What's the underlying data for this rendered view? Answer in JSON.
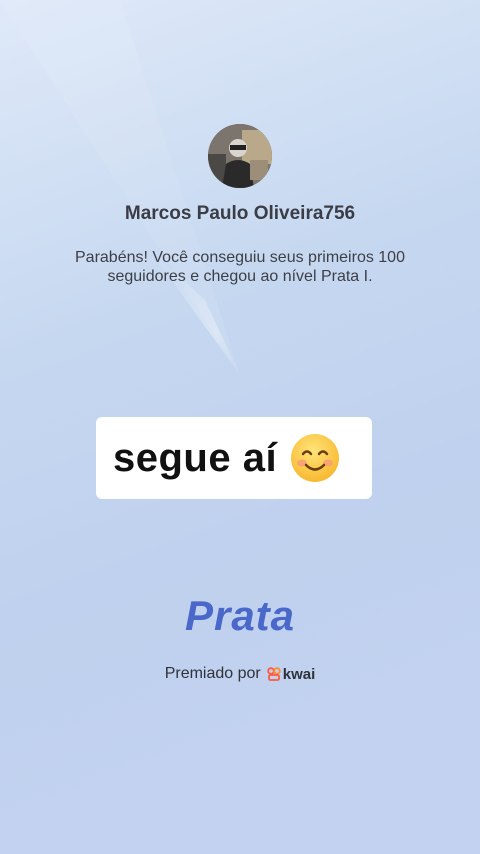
{
  "profile": {
    "username": "Marcos Paulo Oliveira756",
    "avatar_icon": "user-photo"
  },
  "message": "Parabéns! Você conseguiu seus primeiros 100 seguidores e chegou ao nível Prata I.",
  "sticker": {
    "text": "segue aí",
    "emoji_icon": "smiling-face-emoji"
  },
  "tier": {
    "label": "Prata",
    "color": "#4a68c9"
  },
  "award": {
    "prefix": "Premiado por",
    "brand": "kwai",
    "brand_icon": "kwai-logo-icon",
    "brand_color": "#ff5a3c"
  }
}
